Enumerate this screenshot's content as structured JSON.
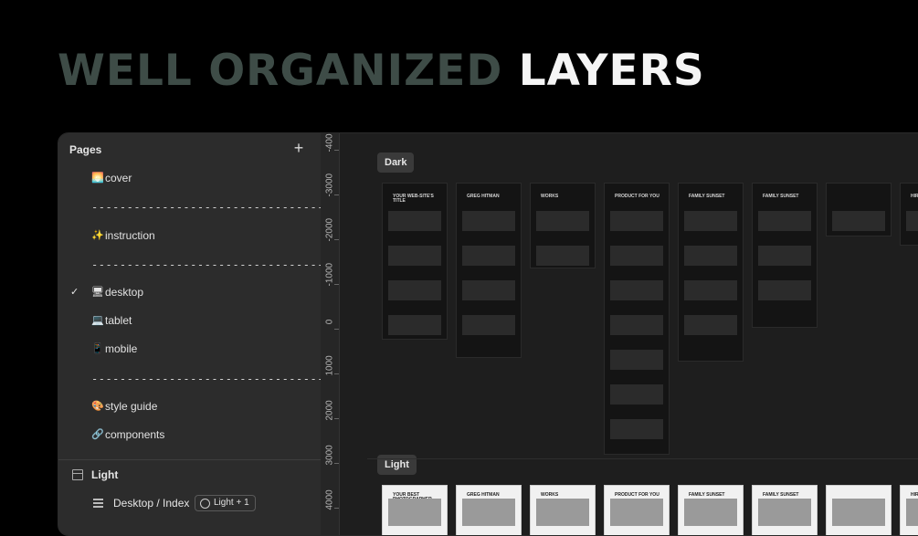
{
  "headline": {
    "muted": "WELL ORGANIZED",
    "bright": "LAYERS"
  },
  "pages_panel": {
    "title": "Pages",
    "add_icon": "plus-icon",
    "items": [
      {
        "icon": "🌅",
        "label": "cover",
        "selected": false
      },
      {
        "separator": "-----------------------------------"
      },
      {
        "icon": "✨",
        "label": "instruction",
        "selected": false
      },
      {
        "separator": "-----------------------------------"
      },
      {
        "icon": "🖥",
        "label": "desktop",
        "selected": true
      },
      {
        "icon": "💻",
        "label": "tablet",
        "selected": false
      },
      {
        "icon": "📱",
        "label": "mobile",
        "selected": false
      },
      {
        "separator": "-----------------------------------"
      },
      {
        "icon": "🎨",
        "label": "style guide",
        "selected": false
      },
      {
        "icon": "🔗",
        "label": "components",
        "selected": false
      }
    ]
  },
  "layers": {
    "section": "Light",
    "frame": "Desktop / Index",
    "badge": "Light + 1"
  },
  "ruler": {
    "ticks": [
      "-4000",
      "-3000",
      "-2000",
      "-1000",
      "0",
      "1000",
      "2000",
      "3000",
      "4000"
    ]
  },
  "canvas": {
    "dark_label": "Dark",
    "light_label": "Light",
    "dark_frames": [
      {
        "title": "YOUR WEB-SITE'S TITLE"
      },
      {
        "title": "GREG HITMAN"
      },
      {
        "title": "WORKS"
      },
      {
        "title": "PRODUCT FOR YOU"
      },
      {
        "title": "FAMILY SUNSET"
      },
      {
        "title": "FAMILY SUNSET"
      },
      {
        "title": ""
      },
      {
        "title": "HIRE ME"
      }
    ],
    "light_frames": [
      {
        "title": "YOUR BEST PHOTOGRAPHER"
      },
      {
        "title": "GREG HITMAN"
      },
      {
        "title": "WORKS"
      },
      {
        "title": "PRODUCT FOR YOU"
      },
      {
        "title": "FAMILY SUNSET"
      },
      {
        "title": "FAMILY SUNSET"
      },
      {
        "title": ""
      },
      {
        "title": "HIRE ME"
      }
    ]
  }
}
